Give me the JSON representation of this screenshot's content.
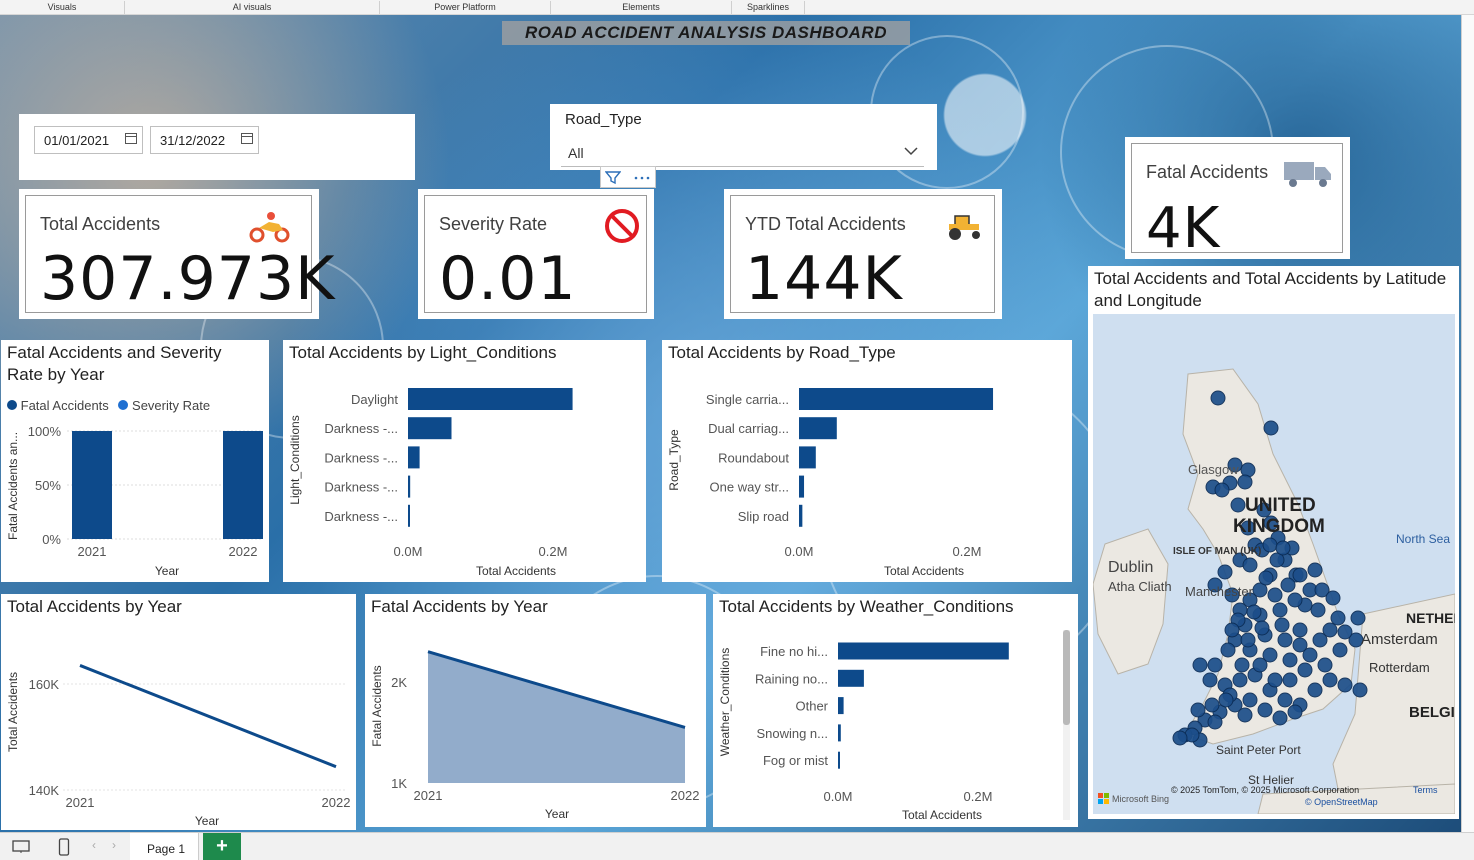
{
  "ribbon": {
    "groups": [
      "Visuals",
      "AI visuals",
      "Power Platform",
      "Elements",
      "Sparklines"
    ]
  },
  "dashboard_title": "ROAD ACCIDENT ANALYSIS DASHBOARD",
  "date_filter": {
    "start": "01/01/2021",
    "end": "31/12/2022"
  },
  "road_type_slicer": {
    "label": "Road_Type",
    "selected": "All"
  },
  "kpis": {
    "total_accidents": {
      "label": "Total Accidents",
      "value": "307.973K",
      "icon": "motorbike-icon"
    },
    "severity_rate": {
      "label": "Severity Rate",
      "value": "0.01",
      "icon": "no-entry-icon"
    },
    "ytd_total": {
      "label": "YTD Total Accidents",
      "value": "144K",
      "icon": "tractor-icon"
    },
    "fatal_accidents": {
      "label": "Fatal Accidents",
      "value": "4K",
      "icon": "truck-icon"
    }
  },
  "colors": {
    "primary": "#0d4a8b",
    "area_fill": "#8ca8c8",
    "accent_light": "#1f6fd1"
  },
  "charts": {
    "fatal_severity": {
      "title": "Fatal Accidents and Severity Rate by Year",
      "legend": [
        "Fatal Accidents",
        "Severity Rate"
      ],
      "xlabel": "Year",
      "ylabel": "Fatal Accidents an...",
      "yticks": [
        "100%",
        "50%",
        "0%"
      ]
    },
    "light": {
      "title": "Total Accidents by Light_Conditions",
      "xlabel": "Total Accidents",
      "ylabel": "Light_Conditions",
      "xticks": [
        "0.0M",
        "0.2M"
      ]
    },
    "road": {
      "title": "Total Accidents by Road_Type",
      "xlabel": "Total Accidents",
      "ylabel": "Road_Type",
      "xticks": [
        "0.0M",
        "0.2M"
      ]
    },
    "year_line": {
      "title": "Total Accidents by Year",
      "xlabel": "Year",
      "ylabel": "Total Accidents",
      "yticks": [
        "160K",
        "140K"
      ]
    },
    "fatal_year": {
      "title": "Fatal Accidents by Year",
      "xlabel": "Year",
      "ylabel": "Fatal Accidents",
      "yticks": [
        "2K",
        "1K"
      ]
    },
    "weather": {
      "title": "Total Accidents by Weather_Conditions",
      "xlabel": "Total Accidents",
      "ylabel": "Weather_Conditions",
      "xticks": [
        "0.0M",
        "0.2M"
      ]
    },
    "map": {
      "title": "Total Accidents and Total Accidents by Latitude and Longitude",
      "labels": [
        "UNITED KINGDOM",
        "Glasgow",
        "ISLE OF MAN (UK)",
        "Dublin",
        "Atha Cliath",
        "Manchester",
        "North Sea",
        "NETHER",
        "Amsterdam",
        "Rotterdam",
        "BELGI",
        "Saint Peter Port",
        "St Helier"
      ],
      "attribution": "© 2025 TomTom, © 2025 Microsoft Corporation",
      "terms": "Terms",
      "osm": "© OpenStreetMap",
      "bing": "Microsoft Bing"
    }
  },
  "chart_data": [
    {
      "type": "bar",
      "title": "Fatal Accidents and Severity Rate by Year",
      "categories": [
        "2021",
        "2022"
      ],
      "series": [
        {
          "name": "Fatal Accidents",
          "values": [
            1,
            1
          ]
        }
      ],
      "ylim": [
        0,
        1
      ]
    },
    {
      "type": "bar",
      "title": "Total Accidents by Light_Conditions",
      "categories": [
        "Daylight",
        "Darkness -...",
        "Darkness -...",
        "Darkness -...",
        "Darkness -..."
      ],
      "values": [
        227000,
        60000,
        16000,
        3000,
        1500
      ],
      "xlim": [
        0,
        250000
      ]
    },
    {
      "type": "bar",
      "title": "Total Accidents by Road_Type",
      "categories": [
        "Single carria...",
        "Dual carriag...",
        "Roundabout",
        "One way str...",
        "Slip road"
      ],
      "values": [
        231000,
        45000,
        20000,
        6000,
        4000
      ],
      "xlim": [
        0,
        250000
      ]
    },
    {
      "type": "line",
      "title": "Total Accidents by Year",
      "x": [
        "2021",
        "2022"
      ],
      "values": [
        163500,
        144400
      ],
      "ylim": [
        140000,
        167000
      ]
    },
    {
      "type": "area",
      "title": "Fatal Accidents by Year",
      "x": [
        "2021",
        "2022"
      ],
      "values": [
        2300,
        1550
      ],
      "ylim": [
        1000,
        2500
      ]
    },
    {
      "type": "bar",
      "title": "Total Accidents by Weather_Conditions",
      "categories": [
        "Fine no hi...",
        "Raining no...",
        "Other",
        "Snowing n...",
        "Fog or mist"
      ],
      "values": [
        244000,
        37000,
        8000,
        4000,
        2000
      ],
      "xlim": [
        0,
        250000
      ]
    }
  ],
  "map_points": [
    [
      1218,
      398
    ],
    [
      1271,
      428
    ],
    [
      1235,
      465
    ],
    [
      1248,
      470
    ],
    [
      1230,
      483
    ],
    [
      1213,
      487
    ],
    [
      1222,
      490
    ],
    [
      1245,
      482
    ],
    [
      1238,
      505
    ],
    [
      1248,
      528
    ],
    [
      1255,
      545
    ],
    [
      1262,
      550
    ],
    [
      1240,
      560
    ],
    [
      1225,
      572
    ],
    [
      1215,
      585
    ],
    [
      1232,
      595
    ],
    [
      1250,
      565
    ],
    [
      1270,
      575
    ],
    [
      1285,
      560
    ],
    [
      1292,
      548
    ],
    [
      1278,
      538
    ],
    [
      1296,
      575
    ],
    [
      1310,
      590
    ],
    [
      1322,
      590
    ],
    [
      1305,
      605
    ],
    [
      1280,
      610
    ],
    [
      1260,
      615
    ],
    [
      1245,
      625
    ],
    [
      1235,
      640
    ],
    [
      1250,
      650
    ],
    [
      1270,
      655
    ],
    [
      1290,
      660
    ],
    [
      1310,
      655
    ],
    [
      1325,
      665
    ],
    [
      1340,
      650
    ],
    [
      1356,
      640
    ],
    [
      1358,
      618
    ],
    [
      1345,
      632
    ],
    [
      1330,
      630
    ],
    [
      1300,
      630
    ],
    [
      1285,
      640
    ],
    [
      1265,
      635
    ],
    [
      1250,
      600
    ],
    [
      1240,
      610
    ],
    [
      1260,
      590
    ],
    [
      1275,
      595
    ],
    [
      1288,
      585
    ],
    [
      1300,
      575
    ],
    [
      1315,
      570
    ],
    [
      1238,
      620
    ],
    [
      1228,
      650
    ],
    [
      1215,
      665
    ],
    [
      1200,
      665
    ],
    [
      1210,
      680
    ],
    [
      1225,
      685
    ],
    [
      1240,
      680
    ],
    [
      1255,
      675
    ],
    [
      1270,
      690
    ],
    [
      1285,
      700
    ],
    [
      1300,
      705
    ],
    [
      1315,
      690
    ],
    [
      1330,
      680
    ],
    [
      1345,
      685
    ],
    [
      1360,
      690
    ],
    [
      1250,
      700
    ],
    [
      1235,
      705
    ],
    [
      1220,
      712
    ],
    [
      1205,
      720
    ],
    [
      1195,
      728
    ],
    [
      1185,
      735
    ],
    [
      1200,
      740
    ],
    [
      1215,
      722
    ],
    [
      1230,
      695
    ],
    [
      1245,
      715
    ],
    [
      1265,
      710
    ],
    [
      1280,
      718
    ],
    [
      1295,
      712
    ],
    [
      1275,
      680
    ],
    [
      1260,
      665
    ],
    [
      1290,
      680
    ],
    [
      1305,
      670
    ],
    [
      1320,
      640
    ],
    [
      1338,
      618
    ],
    [
      1300,
      645
    ],
    [
      1282,
      625
    ],
    [
      1262,
      628
    ],
    [
      1248,
      640
    ],
    [
      1232,
      630
    ],
    [
      1271,
      523
    ],
    [
      1264,
      510
    ],
    [
      1277,
      560
    ],
    [
      1266,
      578
    ],
    [
      1254,
      612
    ],
    [
      1242,
      665
    ],
    [
      1226,
      700
    ],
    [
      1212,
      705
    ],
    [
      1198,
      710
    ],
    [
      1192,
      735
    ],
    [
      1180,
      738
    ],
    [
      1270,
      545
    ],
    [
      1283,
      548
    ],
    [
      1295,
      600
    ],
    [
      1318,
      610
    ],
    [
      1333,
      598
    ]
  ]
}
